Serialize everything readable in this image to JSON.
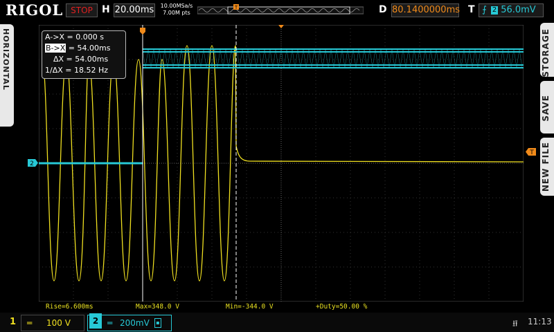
{
  "brand": "RIGOL",
  "run_state": "STOP",
  "horizontal": {
    "label": "H",
    "timebase": "20.00ms",
    "sample_rate": "10.00MSa/s",
    "memory": "7.00M pts"
  },
  "delay": {
    "label": "D",
    "value": "80.1400000ms"
  },
  "trigger": {
    "label": "T",
    "edge_symbol": "⨍",
    "channel": "2",
    "level": "56.0mV"
  },
  "left_tab": "HORIZONTAL",
  "right_tabs": [
    "STORAGE",
    "SAVE",
    "NEW FILE"
  ],
  "cursor_panel": {
    "ax": "A->X = 0.000 s",
    "bx_key": "B->X",
    "bx_val": "= 54.00ms",
    "dx": "ΔX = 54.00ms",
    "inv_dx": "1/ΔX = 18.52 Hz"
  },
  "measurements": {
    "rise": "Rise=6.600ms",
    "max": "Max=348.0 V",
    "min": "Min=-344.0 V",
    "duty": "+Duty=50.00 %"
  },
  "channel1": {
    "number": "1",
    "coupling_icon": "dc-coupling-icon",
    "scale": "100 V",
    "color": "#f0e020"
  },
  "channel2": {
    "number": "2",
    "coupling_icon": "dc-coupling-icon",
    "scale": "200mV",
    "color": "#27c9d6"
  },
  "markers": {
    "ch2_ground": "2",
    "trigger_level": "T"
  },
  "clock": "11:13",
  "usb_icon": "usb-icon"
}
